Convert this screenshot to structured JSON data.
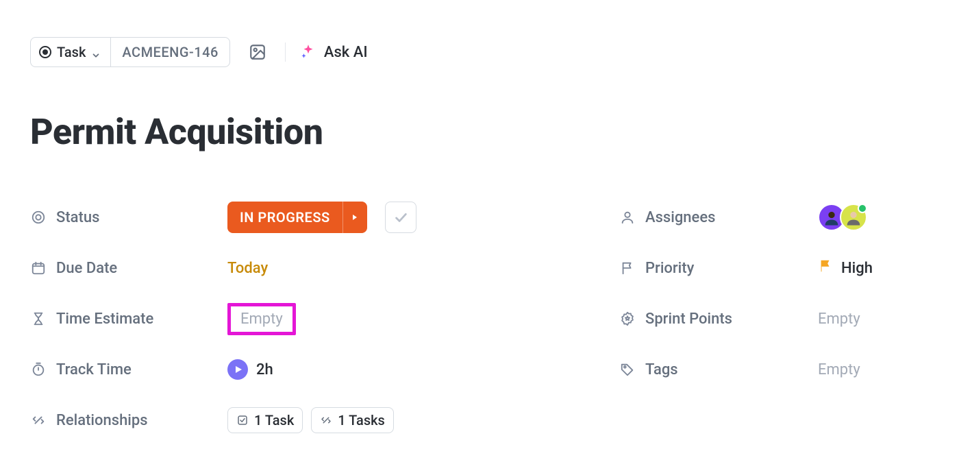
{
  "breadcrumb": {
    "task_type_label": "Task",
    "task_id": "ACMEENG-146",
    "ask_ai_label": "Ask AI"
  },
  "title": "Permit Acquisition",
  "fields": {
    "status": {
      "label": "Status",
      "value": "IN PROGRESS"
    },
    "due_date": {
      "label": "Due Date",
      "value": "Today"
    },
    "time_estimate": {
      "label": "Time Estimate",
      "value": "Empty"
    },
    "track_time": {
      "label": "Track Time",
      "value": "2h"
    },
    "relationships": {
      "label": "Relationships",
      "chip1": "1 Task",
      "chip2": "1 Tasks"
    },
    "assignees": {
      "label": "Assignees"
    },
    "priority": {
      "label": "Priority",
      "value": "High"
    },
    "sprint_points": {
      "label": "Sprint Points",
      "value": "Empty"
    },
    "tags": {
      "label": "Tags",
      "value": "Empty"
    }
  },
  "colors": {
    "status_bg": "#ea5a1f",
    "highlight": "#e416d6",
    "due_today": "#c78a08",
    "priority_flag": "#f5a623"
  }
}
